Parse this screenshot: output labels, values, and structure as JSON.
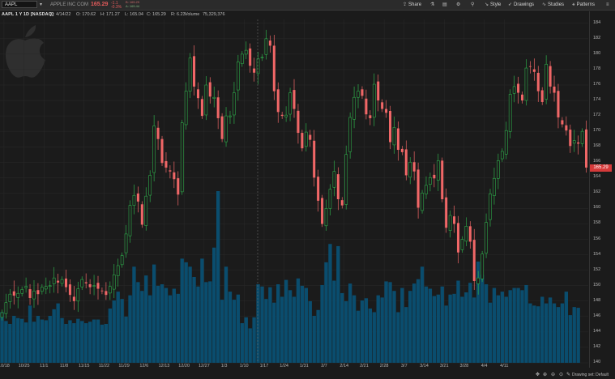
{
  "header": {
    "symbol": "AAPL",
    "company": "APPLE INC COM",
    "last": "165.29",
    "change_abs": "-1.1",
    "change_pct": "-0.3%",
    "bid": "B: 165.29",
    "ask": "A: 165.44"
  },
  "toolbar": {
    "share": "Share",
    "style": "Style",
    "drawings": "Drawings",
    "studies": "Studies",
    "patterns": "Patterns"
  },
  "info": {
    "title": "AAPL 1 Y 1D [NASDAQ]",
    "date": "D: 4/14/22",
    "open": "O: 170.62",
    "high": "H: 171.27",
    "low": "L: 165.04",
    "close": "C: 165.29",
    "range": "R: 6.23",
    "volume_label": "Volume",
    "volume": "75,329,376"
  },
  "footer": {
    "drawing_set": "Drawing set: Default"
  },
  "colors": {
    "up": "#2eab4a",
    "down": "#f06767",
    "volume": "#0a4d6e",
    "grid": "#2a2a2a",
    "background": "#1b1b1b"
  },
  "icons": [
    "apple-logo",
    "share-icon",
    "flask-icon",
    "print-icon",
    "gear-icon",
    "cursor-icon",
    "studies-icon",
    "patterns-icon"
  ],
  "chart_data": {
    "type": "candlestick",
    "y_ticks": [
      140,
      142,
      144,
      146,
      148,
      150,
      152,
      154,
      156,
      158,
      160,
      162,
      164,
      166,
      168,
      170,
      172,
      174,
      176,
      178,
      180,
      182,
      184
    ],
    "ylim": [
      140,
      184.5
    ],
    "x_tick_labels": [
      "10/18",
      "10/25",
      "11/1",
      "11/8",
      "11/15",
      "11/22",
      "11/29",
      "12/6",
      "12/13",
      "12/20",
      "12/27",
      "1/3",
      "1/10",
      "1/17",
      "1/24",
      "1/31",
      "2/7",
      "2/14",
      "2/21",
      "2/28",
      "3/7",
      "3/14",
      "3/21",
      "3/28",
      "4/4",
      "4/11"
    ],
    "bars_per_week": 5,
    "current_price": "165.29",
    "closes": [
      146.5,
      147.8,
      148.9,
      148.7,
      149.0,
      149.5,
      149.9,
      148.4,
      149.3,
      148.9,
      149.8,
      149.9,
      150.0,
      151.0,
      150.4,
      150.8,
      149.8,
      148.8,
      148.0,
      149.6,
      150.8,
      150.3,
      149.8,
      150.0,
      149.6,
      149.3,
      148.8,
      149.9,
      151.4,
      152.6,
      153.9,
      156.7,
      160.4,
      161.7,
      160.9,
      157.9,
      161.6,
      164.3,
      170.7,
      169.0,
      165.9,
      165.3,
      164.8,
      163.8,
      161.8,
      171.1,
      175.2,
      179.5,
      175.8,
      174.3,
      172.0,
      176.0,
      174.5,
      174.4,
      171.7,
      169.0,
      172.0,
      172.0,
      175.0,
      179.0,
      180.0,
      180.5,
      178.5,
      177.6,
      179.4,
      179.6,
      182.0,
      181.1,
      175.2,
      172.5,
      172.0,
      172.1,
      175.0,
      172.9,
      169.8,
      167.8,
      169.9,
      168.9,
      164.0,
      161.0,
      158.0,
      160.0,
      162.5,
      164.8,
      161.2,
      160.4,
      167.0,
      171.8,
      174.4,
      175.2,
      174.6,
      172.2,
      171.7,
      176.1,
      174.0,
      172.9,
      172.4,
      168.6,
      170.5,
      167.6,
      167.3,
      164.3,
      166.0,
      164.8,
      160.1,
      162.0,
      163.0,
      164.0,
      163.9,
      166.2,
      161.2,
      157.5,
      159.1,
      158.0,
      154.3,
      156.0,
      157.7,
      155.7,
      150.6,
      151.0,
      154.1,
      158.2,
      161.9,
      163.9,
      166.2,
      167.4,
      170.1,
      174.8,
      175.8,
      175.0,
      174.0,
      178.2,
      178.4,
      177.7,
      175.2,
      173.8,
      178.7,
      175.8,
      175.0,
      171.8,
      170.9,
      170.1,
      168.1,
      168.8,
      168.4,
      170.0,
      165.3
    ],
    "volumes_millions": [
      69,
      57,
      53,
      64,
      61,
      60,
      55,
      78,
      56,
      64,
      59,
      58,
      64,
      73,
      81,
      61,
      53,
      58,
      54,
      60,
      57,
      54,
      56,
      59,
      59,
      52,
      53,
      74,
      85,
      97,
      87,
      63,
      92,
      131,
      110,
      98,
      119,
      92,
      134,
      105,
      107,
      102,
      92,
      101,
      94,
      142,
      137,
      131,
      117,
      104,
      142,
      110,
      111,
      157,
      234,
      86,
      131,
      97,
      86,
      93,
      54,
      62,
      47,
      62,
      107,
      104,
      87,
      103,
      82,
      107,
      90,
      113,
      99,
      90,
      115,
      105,
      102,
      84,
      64,
      72,
      106,
      137,
      162,
      112,
      159,
      95,
      84,
      108,
      92,
      71,
      85,
      88,
      74,
      69,
      92,
      89,
      111,
      110,
      98,
      69,
      102,
      76,
      98,
      108,
      114,
      131,
      104,
      101,
      91,
      93,
      104,
      78,
      93,
      94,
      112,
      90,
      96,
      109,
      89,
      138,
      120,
      107,
      82,
      102,
      92,
      97,
      90,
      99,
      102,
      102,
      99,
      106,
      81,
      78,
      77,
      90,
      81,
      89,
      81,
      76,
      81,
      97,
      65,
      76,
      75
    ]
  }
}
